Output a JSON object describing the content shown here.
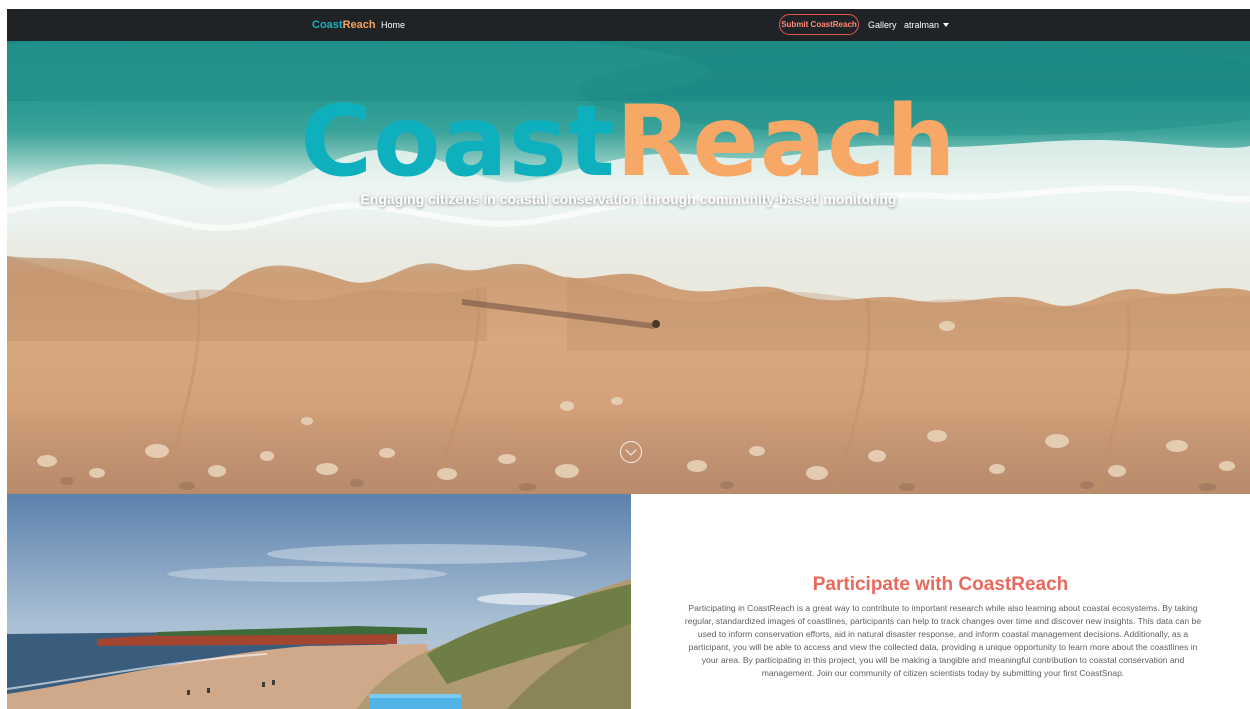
{
  "navbar": {
    "brand_part1": "Coast",
    "brand_part2": "Reach",
    "home": "Home",
    "submit": "Submit CoastReach",
    "gallery": "Gallery",
    "user": "atralman"
  },
  "hero": {
    "title_part1": "Coast",
    "title_part2": "Reach",
    "subtitle": "Engaging citizens in coastal conservation through community-based monitoring"
  },
  "participate": {
    "heading": "Participate with CoastReach",
    "body": "Participating in CoastReach is a great way to contribute to important research while also learning about coastal ecosystems. By taking regular, standardized images of coastlines, participants can help to track changes over time and discover new insights. This data can be used to inform conservation efforts, aid in natural disaster response, and inform coastal management decisions. Additionally, as a participant, you will be able to access and view the collected data, providing a unique opportunity to learn more about the coastlines in your area. By participating in this project, you will be making a tangible and meaningful contribution to coastal conservation and management. Join our community of citizen scientists today by submitting your first CoastSnap."
  },
  "colors": {
    "navbar_bg": "#1f2326",
    "brand_teal": "#16b3bf",
    "brand_orange": "#f6a25c",
    "submit_border": "#e4534f",
    "heading": "#e9695c"
  }
}
